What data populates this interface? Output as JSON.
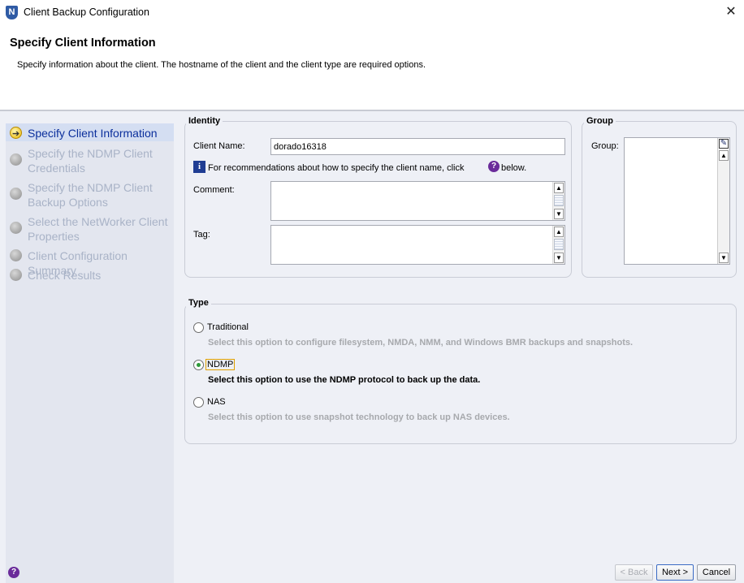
{
  "window": {
    "title": "Client Backup Configuration",
    "logo_letter": "N",
    "close_glyph": "✕"
  },
  "header": {
    "title": "Specify Client Information",
    "subtitle": "Specify information about the client.  The hostname of the client and the client type are required options."
  },
  "steps": [
    {
      "label": "Specify Client Information",
      "active": true
    },
    {
      "label": "Specify the NDMP Client Credentials",
      "active": false
    },
    {
      "label": "Specify the NDMP Client Backup Options",
      "active": false
    },
    {
      "label": "Select the NetWorker Client Properties",
      "active": false
    },
    {
      "label": "Client Configuration Summary",
      "active": false
    },
    {
      "label": "Check Results",
      "active": false
    }
  ],
  "identity": {
    "legend": "Identity",
    "client_name_label": "Client Name:",
    "client_name_value": "dorado16318",
    "recommendation_text": "For recommendations about how to specify the client name, click",
    "recommendation_suffix": "below.",
    "info_glyph": "i",
    "help_glyph": "?",
    "comment_label": "Comment:",
    "comment_value": "",
    "tag_label": "Tag:",
    "tag_value": ""
  },
  "group": {
    "legend": "Group",
    "group_label": "Group:",
    "edit_glyph": "✎"
  },
  "type": {
    "legend": "Type",
    "options": [
      {
        "label": "Traditional",
        "description": "Select this option to configure filesystem, NMDA, NMM, and Windows BMR backups and snapshots.",
        "selected": false
      },
      {
        "label": "NDMP",
        "description": "Select this option to use the NDMP protocol to back up the data.",
        "selected": true
      },
      {
        "label": "NAS",
        "description": "Select this option to use snapshot technology to back up NAS devices.",
        "selected": false
      }
    ]
  },
  "footer": {
    "help_glyph": "?",
    "back_label": "< Back",
    "next_label": "Next >",
    "cancel_label": "Cancel"
  },
  "colors": {
    "active_step": "#0b2f9c",
    "inactive_step": "#a9b3c7",
    "help_icon": "#6a2b9a",
    "info_icon": "#1f3d93"
  }
}
